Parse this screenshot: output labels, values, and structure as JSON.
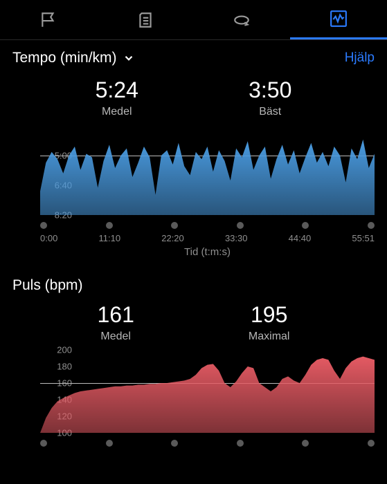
{
  "tabs": {
    "active_index": 3
  },
  "help_link": "Hjälp",
  "tempo": {
    "title": "Tempo (min/km)",
    "avg": {
      "value": "5:24",
      "label": "Medel"
    },
    "best": {
      "value": "3:50",
      "label": "Bäst"
    },
    "yticks": [
      "5:00",
      "6:40",
      "8:20"
    ],
    "xticks": [
      "0:00",
      "11:10",
      "22:20",
      "33:30",
      "44:40",
      "55:51"
    ],
    "xlabel": "Tid (t:m:s)"
  },
  "puls": {
    "title": "Puls (bpm)",
    "avg": {
      "value": "161",
      "label": "Medel"
    },
    "max": {
      "value": "195",
      "label": "Maximal"
    },
    "yticks": [
      "200",
      "180",
      "160",
      "140",
      "120",
      "100"
    ]
  },
  "chart_data": [
    {
      "type": "area",
      "name": "tempo",
      "title": "Tempo (min/km)",
      "xlabel": "Tid (t:m:s)",
      "ylabel": "min/km",
      "y_inverted": true,
      "ylim": [
        3.3,
        8.33
      ],
      "reference_line_y": 5.0,
      "x_seconds": [
        0,
        670,
        1340,
        2010,
        2680,
        3351
      ],
      "series": [
        {
          "name": "Tempo",
          "color": "#4a9be0",
          "values_minkm": [
            7.0,
            5.4,
            4.8,
            5.2,
            6.0,
            5.0,
            4.5,
            5.8,
            4.9,
            5.1,
            6.8,
            5.3,
            4.4,
            5.7,
            5.0,
            4.6,
            6.2,
            5.4,
            4.5,
            5.1,
            7.2,
            5.0,
            4.7,
            5.5,
            4.3,
            5.6,
            6.1,
            4.8,
            5.2,
            4.5,
            5.9,
            4.7,
            5.3,
            6.4,
            4.6,
            5.1,
            4.2,
            5.8,
            5.0,
            4.5,
            6.3,
            5.2,
            4.4,
            5.5,
            4.7,
            6.0,
            5.1,
            4.3,
            5.4,
            4.8,
            5.6,
            4.5,
            5.0,
            6.5,
            4.6,
            5.2,
            4.1,
            5.7,
            4.9
          ]
        }
      ]
    },
    {
      "type": "area",
      "name": "puls",
      "title": "Puls (bpm)",
      "xlabel": "Tid (t:m:s)",
      "ylabel": "bpm",
      "ylim": [
        90,
        200
      ],
      "reference_line_y": 160,
      "x_seconds": [
        0,
        670,
        1340,
        2010,
        2680,
        3351
      ],
      "series": [
        {
          "name": "Puls",
          "color": "#e45a63",
          "values_bpm": [
            100,
            118,
            130,
            138,
            142,
            145,
            148,
            150,
            151,
            152,
            153,
            154,
            155,
            156,
            156,
            157,
            157,
            158,
            158,
            159,
            159,
            160,
            160,
            161,
            162,
            163,
            165,
            170,
            178,
            182,
            183,
            175,
            160,
            155,
            162,
            172,
            180,
            178,
            160,
            155,
            150,
            155,
            165,
            168,
            163,
            160,
            170,
            182,
            188,
            190,
            188,
            175,
            165,
            178,
            186,
            190,
            192,
            190,
            188
          ]
        }
      ]
    }
  ]
}
